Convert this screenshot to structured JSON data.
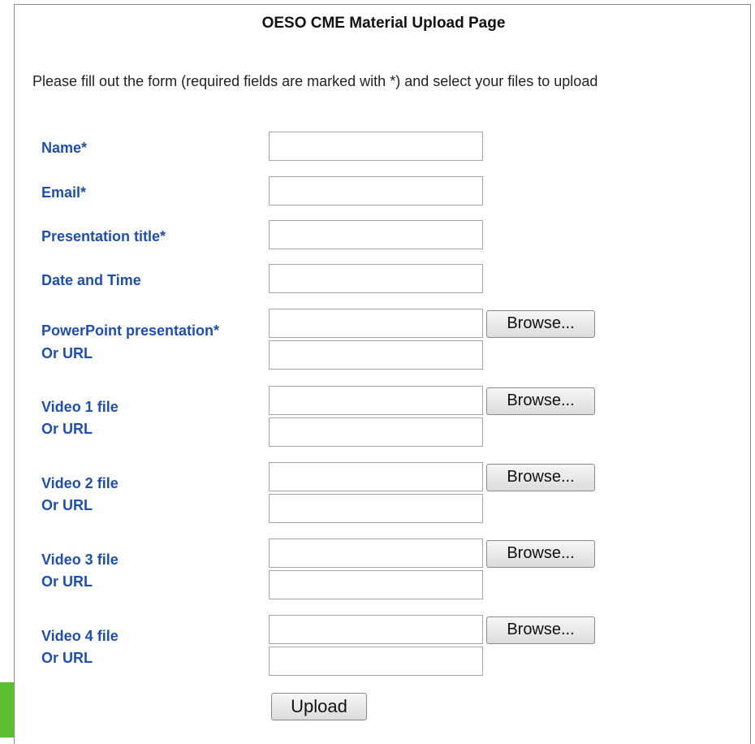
{
  "page": {
    "title": "OESO CME Material Upload Page",
    "instructions": "Please fill out the form (required fields are marked with *) and select your files to upload"
  },
  "form": {
    "name": {
      "label": "Name*",
      "value": ""
    },
    "email": {
      "label": "Email*",
      "value": ""
    },
    "presentation_title": {
      "label": "Presentation title*",
      "value": ""
    },
    "date_time": {
      "label": "Date and Time",
      "value": ""
    },
    "powerpoint": {
      "label": "PowerPoint presentation*",
      "or_url_label": "Or URL",
      "browse_label": "Browse...",
      "url_value": ""
    },
    "video1": {
      "label": "Video 1 file",
      "or_url_label": "Or URL",
      "browse_label": "Browse...",
      "url_value": ""
    },
    "video2": {
      "label": "Video 2 file",
      "or_url_label": "Or URL",
      "browse_label": "Browse...",
      "url_value": ""
    },
    "video3": {
      "label": "Video 3 file",
      "or_url_label": "Or URL",
      "browse_label": "Browse...",
      "url_value": ""
    },
    "video4": {
      "label": "Video 4 file",
      "or_url_label": "Or URL",
      "browse_label": "Browse...",
      "url_value": ""
    },
    "upload_label": "Upload"
  },
  "colors": {
    "label_blue": "#1f4fa8",
    "accent_green": "#5cbf30"
  }
}
